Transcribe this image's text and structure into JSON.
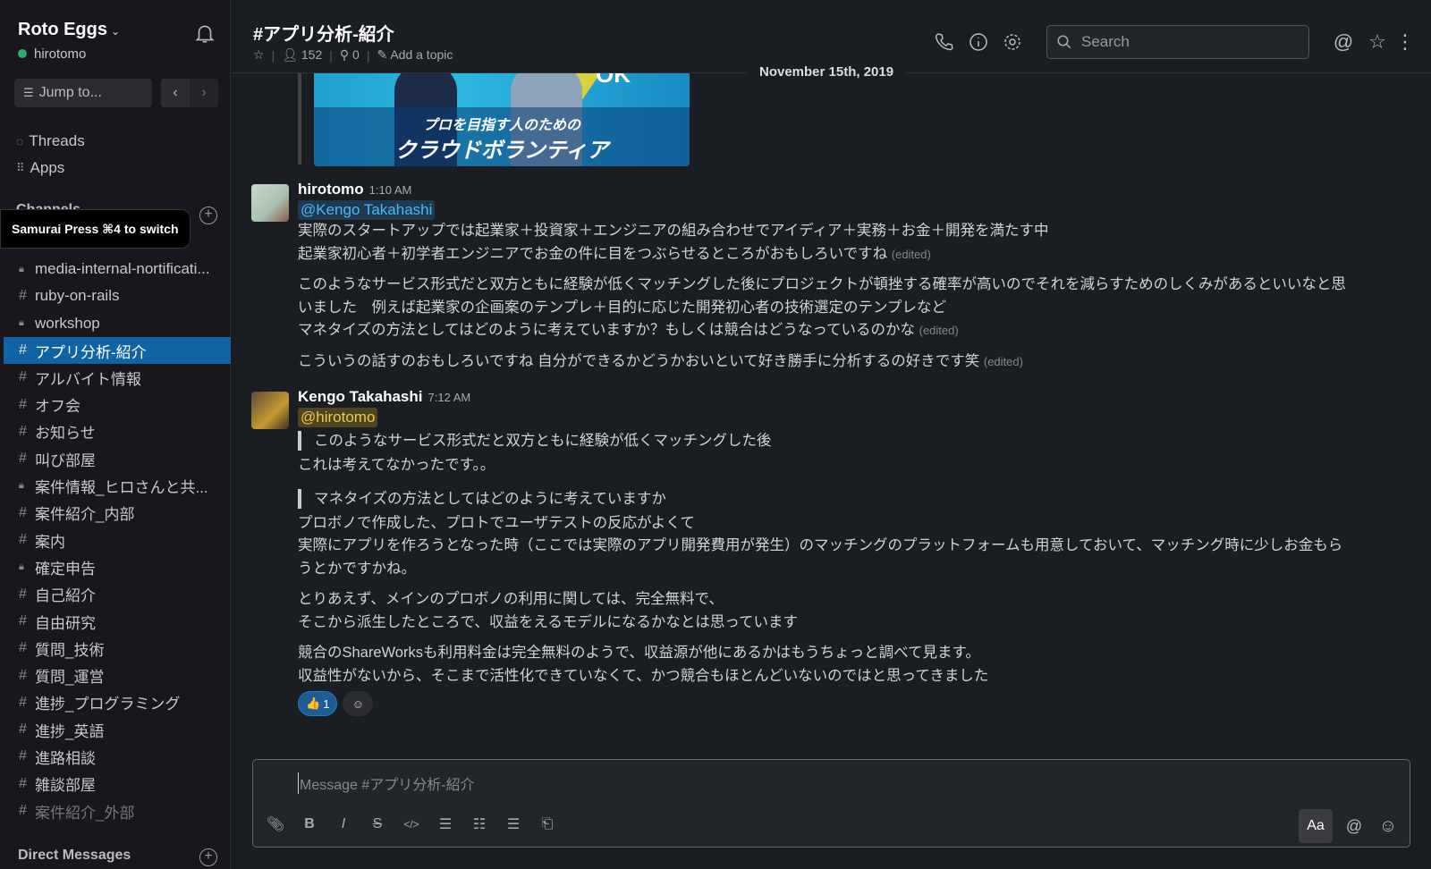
{
  "sidebar": {
    "workspace": "Roto Eggs",
    "user": "hirotomo",
    "status_color": "#2bac76",
    "jump_placeholder": "Jump to...",
    "threads": "Threads",
    "apps": "Apps",
    "channels_heading": "Channels",
    "tooltip": "Samurai Press ⌘4 to switch",
    "channels": [
      {
        "name": "media-internal-nortificati...",
        "private": true
      },
      {
        "name": "ruby-on-rails",
        "private": false
      },
      {
        "name": "workshop",
        "private": true
      },
      {
        "name": "アプリ分析-紹介",
        "private": false,
        "active": true
      },
      {
        "name": "アルバイト情報",
        "private": false
      },
      {
        "name": "オフ会",
        "private": false
      },
      {
        "name": "お知らせ",
        "private": false
      },
      {
        "name": "叫び部屋",
        "private": false
      },
      {
        "name": "案件情報_ヒロさんと共...",
        "private": true
      },
      {
        "name": "案件紹介_内部",
        "private": false
      },
      {
        "name": "案内",
        "private": false
      },
      {
        "name": "確定申告",
        "private": true
      },
      {
        "name": "自己紹介",
        "private": false
      },
      {
        "name": "自由研究",
        "private": false
      },
      {
        "name": "質問_技術",
        "private": false
      },
      {
        "name": "質問_運営",
        "private": false
      },
      {
        "name": "進捗_プログラミング",
        "private": false
      },
      {
        "name": "進捗_英語",
        "private": false
      },
      {
        "name": "進路相談",
        "private": false
      },
      {
        "name": "雑談部屋",
        "private": false
      },
      {
        "name": "案件紹介_外部",
        "private": false,
        "muted": true
      }
    ],
    "direct_messages": "Direct Messages",
    "active_color": "#1164a3"
  },
  "header": {
    "title": "#アプリ分析-紹介",
    "members": "152",
    "pins": "0",
    "topic": "Add a topic",
    "search_placeholder": "Search"
  },
  "date_divider": "November 15th, 2019",
  "banner": {
    "line1": "プロを目指す人のための",
    "line2": "クラウドボランティア",
    "corner": "OK"
  },
  "messages": [
    {
      "author": "hirotomo",
      "time": "1:10 AM",
      "mention": "@Kengo Takahashi",
      "lines": [
        "実際のスタートアップでは起業家＋投資家＋エンジニアの組み合わせでアイディア＋実務＋お金＋開発を満たす中",
        "起業家初心者＋初学者エンジニアでお金の件に目をつぶらせるところがおもしろいですね"
      ],
      "para2": [
        "このようなサービス形式だと双方ともに経験が低くマッチングした後にプロジェクトが頓挫する確率が高いのでそれを減らすためのしくみがあるといいなと思",
        "いました　例えば起業家の企画案のテンプレ＋目的に応じた開発初心者の技術選定のテンプレなど",
        "マネタイズの方法としてはどのように考えていますか？もしくは競合はどうなっているのかな"
      ],
      "para3": "こういうの話すのおもしろいですね 自分ができるかどうかおいといて好き勝手に分析するの好きです笑",
      "edited": "(edited)"
    },
    {
      "author": "Kengo Takahashi",
      "time": "7:12 AM",
      "mention": "@hirotomo",
      "quote1": "このようなサービス形式だと双方ともに経験が低くマッチングした後",
      "reply1": "これは考えてなかったです。。",
      "quote2": "マネタイズの方法としてはどのように考えていますか",
      "para1": [
        "プロボノで作成した、プロトでユーザテストの反応がよくて",
        "実際にアプリを作ろうとなった時（ここでは実際のアプリ開発費用が発生）のマッチングのプラットフォームも用意しておいて、マッチング時に少しお金もら",
        "うとかですかね。"
      ],
      "para2": [
        "とりあえず、メインのプロボノの利用に関しては、完全無料で、",
        "そこから派生したところで、収益をえるモデルになるかなとは思っています"
      ],
      "para3": [
        "競合のShareWorksも利用料金は完全無料のようで、収益源が他にあるかはもうちょっと調べて見ます。",
        "収益性がないから、そこまで活性化できていなくて、かつ競合もほとんどいないのではと思ってきました"
      ],
      "reaction": {
        "emoji": "👍",
        "count": "1"
      }
    }
  ],
  "composer": {
    "placeholder": "Message #アプリ分析-紹介",
    "format_label": "Aa"
  }
}
